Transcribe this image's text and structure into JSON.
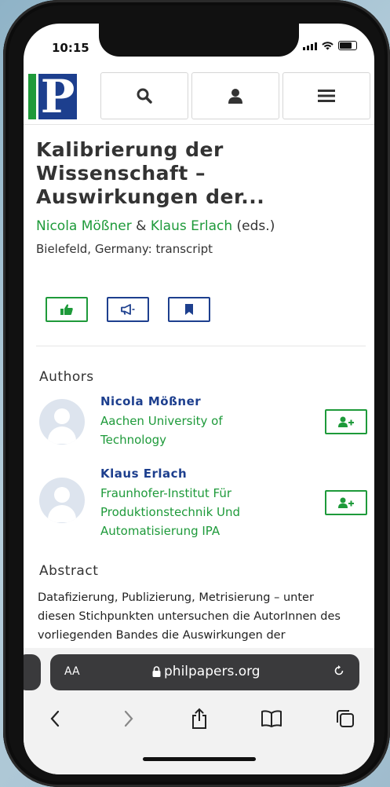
{
  "status": {
    "time": "10:15"
  },
  "header": {
    "logo_letter": "P",
    "nav": [
      {
        "icon": "search-icon"
      },
      {
        "icon": "user-icon"
      },
      {
        "icon": "menu-icon"
      }
    ]
  },
  "book": {
    "title_lines": [
      "Kalibrierung der",
      "Wissenschaft –",
      "Auswirkungen der..."
    ],
    "editor1": "Nicola Mößner",
    "amp": "&",
    "editor2": "Klaus Erlach",
    "eds": "(eds.)",
    "publisher": "Bielefeld, Germany: transcript"
  },
  "actions": [
    {
      "icon": "thumbs-up-icon",
      "color": "#1e9a3a"
    },
    {
      "icon": "megaphone-icon",
      "color": "#1d3f8e"
    },
    {
      "icon": "bookmark-icon",
      "color": "#1d3f8e"
    }
  ],
  "authors_heading": "Authors",
  "authors": [
    {
      "name": "Nicola Mößner",
      "affiliation_lines": [
        "Aachen University of",
        "Technology"
      ]
    },
    {
      "name": "Klaus Erlach",
      "affiliation_lines": [
        "Fraunhofer-Institut Für",
        "Produktionstechnik Und",
        "Automatisierung IPA"
      ]
    }
  ],
  "abstract_heading": "Abstract",
  "abstract_lines": [
    "Datafizierung, Publizierung, Metrisierung – unter",
    "diesen Stichpunkten untersuchen die AutorInnen des",
    "vorliegenden Bandes die Auswirkungen der"
  ],
  "browser": {
    "text_size_label": "AA",
    "url": "philpapers.org"
  },
  "colors": {
    "green": "#1e9a3a",
    "blue": "#1d3f8e"
  }
}
